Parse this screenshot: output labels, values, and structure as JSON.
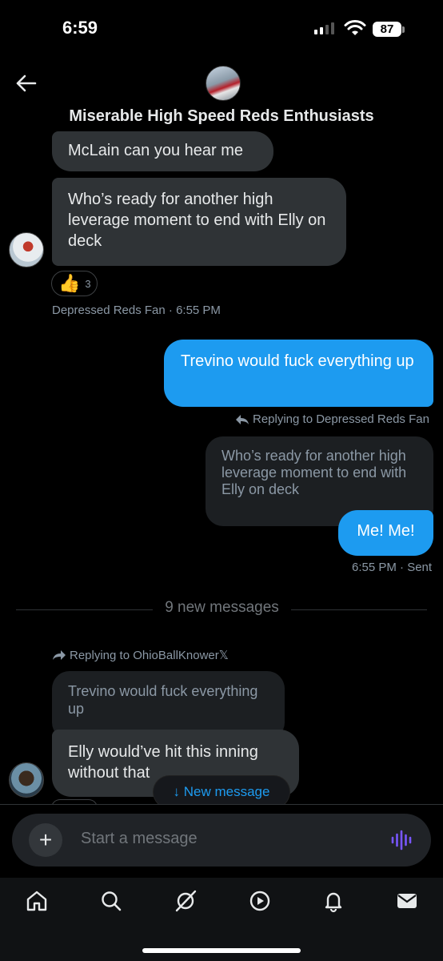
{
  "status_bar": {
    "time": "6:59",
    "battery": "87"
  },
  "header": {
    "title": "Miserable High Speed Reds Enthusiasts"
  },
  "messages": {
    "m1": {
      "text": "McLain can you hear me"
    },
    "m2": {
      "text": "Who’s ready for another high leverage moment to end with Elly on deck",
      "reaction_emoji": "👍",
      "reaction_count": "3",
      "meta": "Depressed Reds Fan · 6:55 PM"
    },
    "m3": {
      "text": "Trevino would fuck everything up",
      "reply_label": "Replying to Depressed Reds Fan"
    },
    "m4": {
      "quoted": "Who’s ready for another high leverage moment to end with Elly on deck",
      "text": "Me! Me!",
      "meta": "6:55 PM · Sent"
    },
    "divider": "9 new messages",
    "m5": {
      "reply_label": "Replying to OhioBallKnower𝕏",
      "quoted": "Trevino would fuck everything up",
      "text": "Elly would’ve hit this inning without that"
    }
  },
  "new_message_button": "↓ New message",
  "composer": {
    "placeholder": "Start a message"
  },
  "tabs": [
    "home-icon",
    "search-icon",
    "grok-icon",
    "video-icon",
    "notifications-icon",
    "messages-icon"
  ],
  "colors": {
    "accent": "#1d9bf0",
    "bubble_received": "#2f3336",
    "mic": "#7856ff"
  }
}
